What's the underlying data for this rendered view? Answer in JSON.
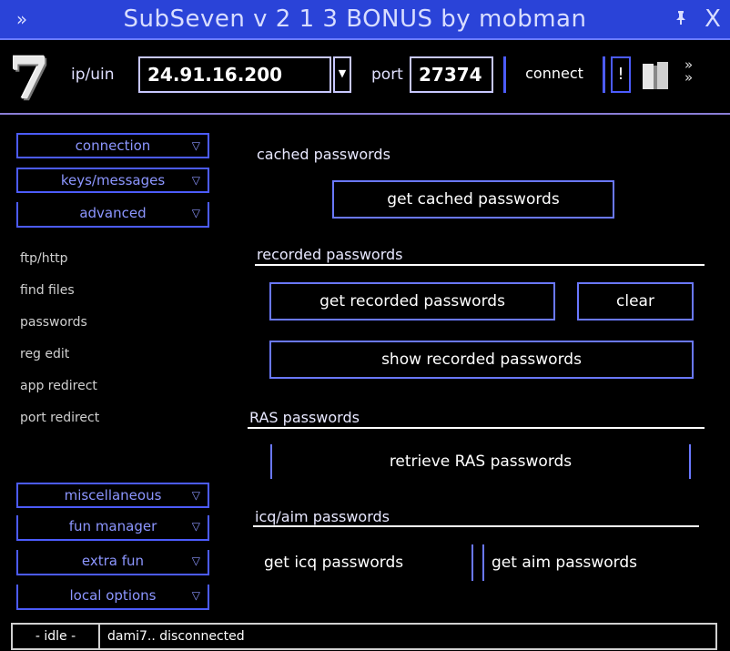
{
  "window": {
    "title": "SubSeven v 2 1 3 BONUS by mobman",
    "menu_icon": "double-chevron-icon",
    "pin_icon": "pin-icon",
    "close_label": "X"
  },
  "connection": {
    "logo": "7",
    "ip_label": "ip/uin",
    "ip_value": "24.91.16.200",
    "port_label": "port",
    "port_value": "27374",
    "connect_label": "connect",
    "bang_label": "!",
    "dropdown_icon": "chevron-down-icon",
    "book_icon": "book-icon",
    "ffwd_icon": "fast-forward-icon",
    "ffwd_glyph": "»\n»"
  },
  "sidebar": {
    "top_buttons": [
      {
        "label": "connection"
      },
      {
        "label": "keys/messages"
      },
      {
        "label": "advanced"
      }
    ],
    "links": [
      "ftp/http",
      "find files",
      "passwords",
      "reg edit",
      "app redirect",
      "port redirect"
    ],
    "bottom_buttons": [
      {
        "label": "miscellaneous"
      },
      {
        "label": "fun manager"
      },
      {
        "label": "extra fun"
      },
      {
        "label": "local options"
      }
    ]
  },
  "main": {
    "cached": {
      "title": "cached passwords",
      "get_button": "get cached passwords"
    },
    "recorded": {
      "title": "recorded passwords",
      "get_button": "get recorded passwords",
      "clear_button": "clear",
      "show_button": "show recorded passwords"
    },
    "ras": {
      "title": "RAS passwords",
      "retrieve_button": "retrieve RAS passwords"
    },
    "icq": {
      "title": "icq/aim passwords",
      "icq_button": "get icq passwords",
      "aim_button": "get aim passwords"
    }
  },
  "status": {
    "left": "- idle -",
    "text": "dami7.. disconnected"
  },
  "colors": {
    "titlebar": "#2a43d8",
    "accent": "#4c5cff",
    "sidebar_text": "#8c96ff"
  }
}
